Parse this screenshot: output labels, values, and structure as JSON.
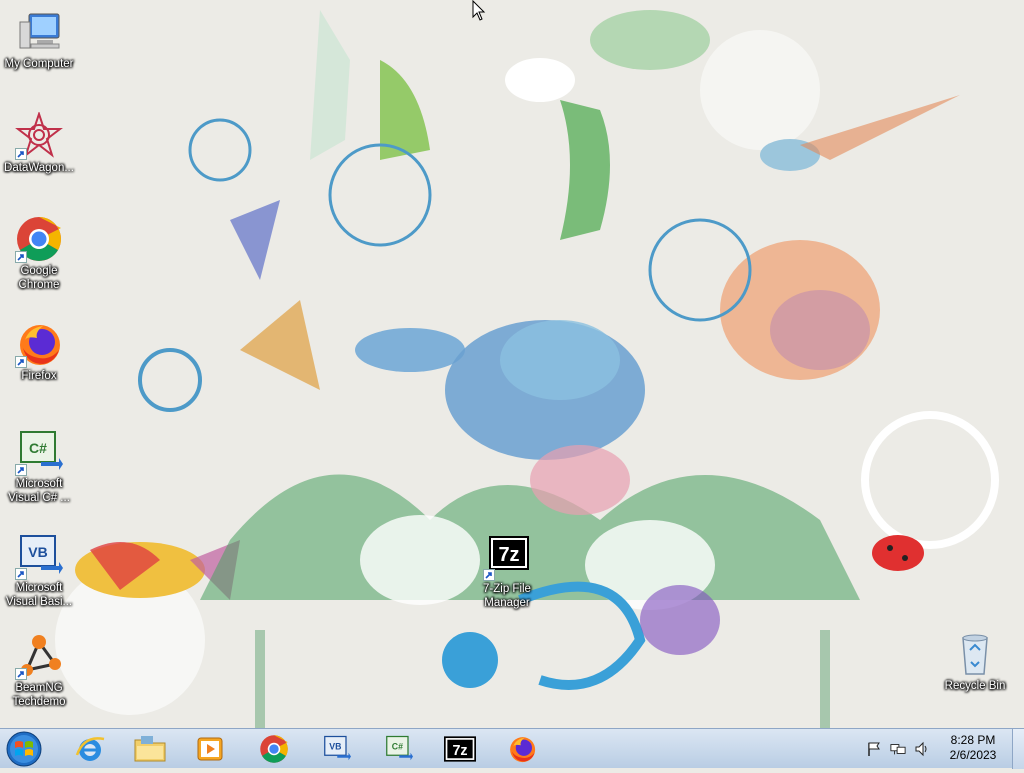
{
  "desktop": {
    "icons": [
      {
        "label": "My Computer",
        "icon": "computer-icon"
      },
      {
        "label": "DataWagon...",
        "icon": "datawagon-icon"
      },
      {
        "label": "Google Chrome",
        "icon": "chrome-icon"
      },
      {
        "label": "Firefox",
        "icon": "firefox-icon"
      },
      {
        "label": "Microsoft Visual C# ...",
        "icon": "visual-csharp-icon"
      },
      {
        "label": "Microsoft Visual Basi...",
        "icon": "visual-basic-icon"
      },
      {
        "label": "BeamNG Techdemo",
        "icon": "beamng-icon"
      },
      {
        "label": "7-Zip File Manager",
        "icon": "7zip-icon"
      },
      {
        "label": "Recycle Bin",
        "icon": "recycle-bin-icon"
      }
    ],
    "seven_zip_glyph": "7z",
    "cs_glyph": "C#",
    "vb_glyph": "VB"
  },
  "taskbar": {
    "pinned": [
      {
        "name": "internet-explorer",
        "icon": "ie-icon"
      },
      {
        "name": "file-explorer",
        "icon": "folder-icon"
      },
      {
        "name": "media-player",
        "icon": "media-player-icon"
      },
      {
        "name": "chrome",
        "icon": "chrome-icon"
      },
      {
        "name": "visual-basic",
        "icon": "visual-basic-icon"
      },
      {
        "name": "visual-csharp",
        "icon": "visual-csharp-icon"
      },
      {
        "name": "7zip",
        "icon": "7zip-icon"
      },
      {
        "name": "firefox",
        "icon": "firefox-icon"
      }
    ]
  },
  "tray": {
    "time": "8:28 PM",
    "date": "2/6/2023",
    "icons": [
      "flag-icon",
      "network-icon",
      "volume-icon"
    ]
  },
  "colors": {
    "taskbar_top": "#dbe6f3",
    "taskbar_bottom": "#b9cde4",
    "desktop_bg": "#ecebe6"
  }
}
